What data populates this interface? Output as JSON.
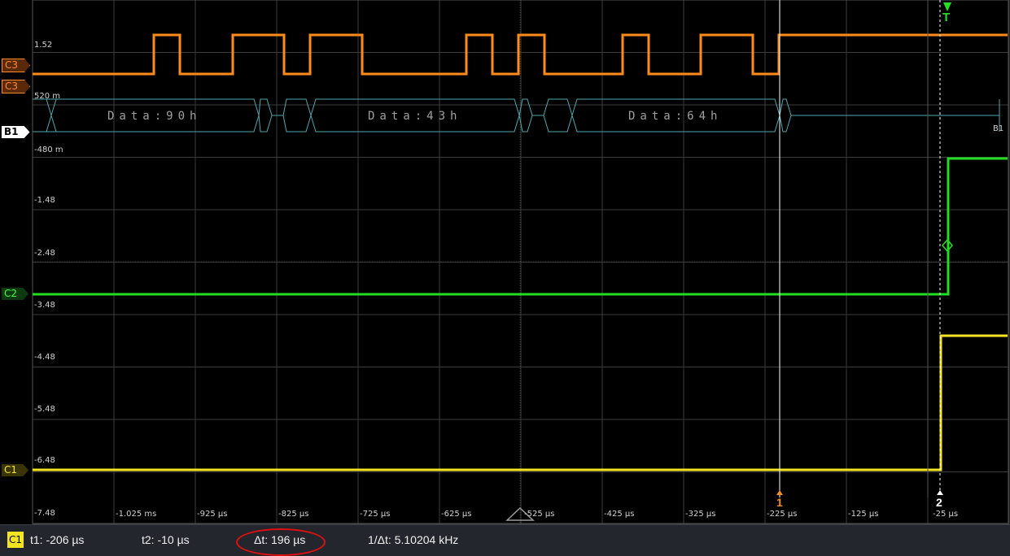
{
  "scope": {
    "y_labels": [
      "1.52",
      "520 m",
      "-480 m",
      "-1.48",
      "-2.48",
      "-3.48",
      "-4.48",
      "-5.48",
      "-6.48",
      "-7.48"
    ],
    "x_labels": [
      "-1.025 ms",
      "-925 µs",
      "-825 µs",
      "-725 µs",
      "-625 µs",
      "-525 µs",
      "-425 µs",
      "-325 µs",
      "-225 µs",
      "-125 µs",
      "-25 µs"
    ],
    "channels": {
      "c3_edge_label": "C3",
      "c3_label": "C3",
      "b1_label": "B1",
      "b1_right_label": "B1",
      "c2_label": "C2",
      "c1_label": "C1"
    },
    "bus_decode": [
      "Data:90h",
      "Data:43h",
      "Data:64h"
    ],
    "trigger_label": "T",
    "cursor1_label": "1",
    "cursor2_label": "2",
    "colors": {
      "c1": "#f4e520",
      "c2": "#22dd22",
      "c3": "#ff8c1a",
      "bus": "#4fa8b0",
      "grid": "#3c3c3c",
      "cursor": "#ffffff",
      "highlight": "#e01010"
    }
  },
  "status": {
    "channel_badge": "C1",
    "t1": "t1: -206 µs",
    "t2": "t2: -10 µs",
    "dt": "Δt: 196 µs",
    "inv_dt": "1/Δt: 5.10204 kHz"
  }
}
